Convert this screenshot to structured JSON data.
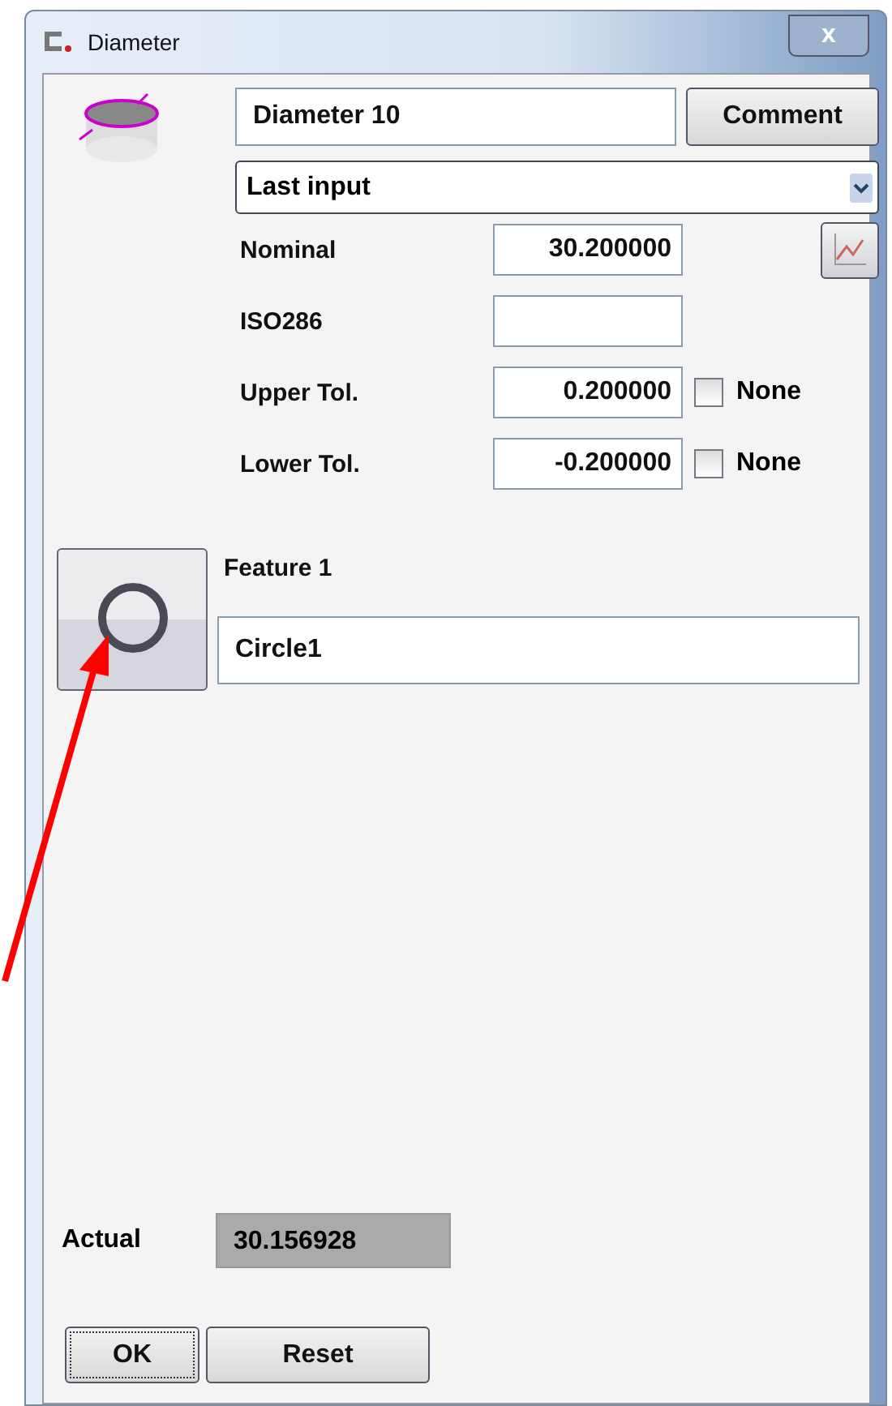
{
  "window": {
    "title": "Diameter",
    "close": "x"
  },
  "name_field": {
    "value": "Diameter 10"
  },
  "comment_button": "Comment",
  "mode_dropdown": {
    "value": "Last input"
  },
  "fields": [
    {
      "kind": "plain",
      "label": "Nominal",
      "value": "30.200000"
    },
    {
      "kind": "plain",
      "label": "ISO286"
    },
    {
      "kind": "tol",
      "label": "Upper Tol.",
      "value": "0.200000",
      "none_label": "None",
      "none_checked": false
    },
    {
      "kind": "tol",
      "label": "Lower Tol.",
      "value": "-0.200000",
      "none_label": "None",
      "none_checked": false
    }
  ],
  "feature": {
    "label": "Feature 1",
    "value": "Circle1"
  },
  "actual": {
    "label": "Actual",
    "value": "30.156928"
  },
  "buttons": [
    "OK",
    "Reset"
  ]
}
